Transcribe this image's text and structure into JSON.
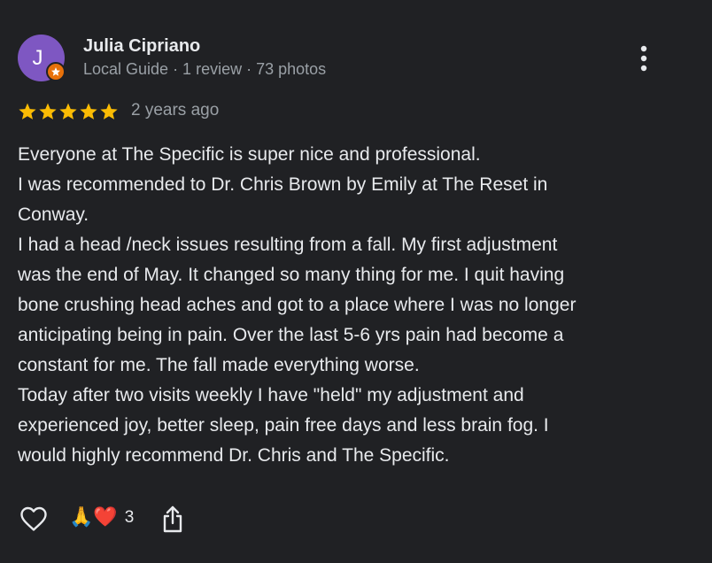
{
  "reviewer": {
    "avatar_initial": "J",
    "name": "Julia Cipriano",
    "meta": "Local Guide · 1 review · 73 photos",
    "avatar_color": "#7e57c2",
    "badge_color": "#e8710a"
  },
  "rating": {
    "stars": 5,
    "max_stars": 5,
    "star_color": "#fbbc04",
    "date": "2 years ago"
  },
  "review_lines": [
    "Everyone at The Specific is super nice and professional.",
    "I was recommended to Dr. Chris Brown by Emily at The Reset in",
    "Conway.",
    "I had a head /neck issues resulting from a fall. My first adjustment",
    "was the end of May. It changed so many thing for me. I quit having",
    "bone crushing head aches and got to a place where I was no longer",
    "anticipating being in pain. Over the last 5-6 yrs pain had become a",
    "constant for me. The fall made everything worse.",
    "Today after two visits weekly I have \"held\" my adjustment and",
    "experienced joy, better sleep, pain free days and less brain fog. I",
    "would highly recommend Dr. Chris and The Specific."
  ],
  "actions": {
    "like_icon": "heart-outline-icon",
    "reaction_emojis": "🙏❤️",
    "reaction_count": "3",
    "share_icon": "share-icon",
    "more_icon": "more-vert-icon"
  }
}
